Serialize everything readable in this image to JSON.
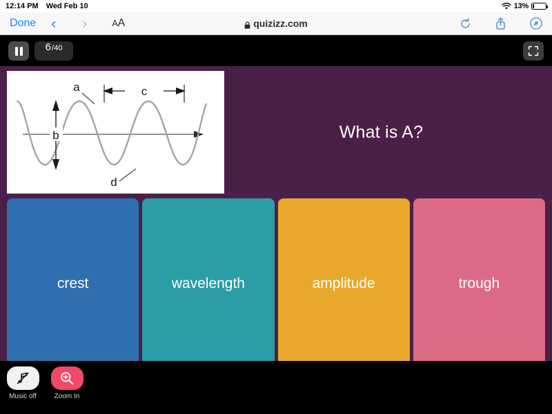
{
  "status_bar": {
    "time": "12:14 PM",
    "date": "Wed Feb 10",
    "wifi_icon": "wifi-icon",
    "battery_percent": "13%",
    "battery_icon": "battery-low-icon"
  },
  "browser": {
    "done_label": "Done",
    "back_icon": "chevron-left-icon",
    "forward_icon": "chevron-right-icon",
    "text_size_small": "A",
    "text_size_large": "A",
    "lock_icon": "lock-icon",
    "url": "quizizz.com",
    "reload_icon": "reload-icon",
    "share_icon": "share-icon",
    "compass_icon": "safari-compass-icon"
  },
  "quiz_bar": {
    "pause_icon": "pause-icon",
    "current_question": "6",
    "total_questions": "/40",
    "fullscreen_icon": "fullscreen-expand-icon"
  },
  "question": {
    "text": "What is A?",
    "image_alt": "transverse-wave-diagram",
    "diagram_labels": {
      "a": "a",
      "b": "b",
      "c": "c",
      "d": "d"
    }
  },
  "options": [
    {
      "label": "crest",
      "color": "#2f6fb0"
    },
    {
      "label": "wavelength",
      "color": "#2a9da6"
    },
    {
      "label": "amplitude",
      "color": "#e8a82c"
    },
    {
      "label": "trough",
      "color": "#dd6a84"
    }
  ],
  "dock": {
    "music": {
      "label": "Music off",
      "icon": "music-note-muted-icon"
    },
    "zoom": {
      "label": "Zoom In",
      "icon": "magnifier-plus-icon"
    }
  },
  "colors": {
    "stage_background": "#4a2049",
    "app_background": "#000000",
    "accent_pink": "#f04a68",
    "browser_blue": "#1a84ff"
  }
}
